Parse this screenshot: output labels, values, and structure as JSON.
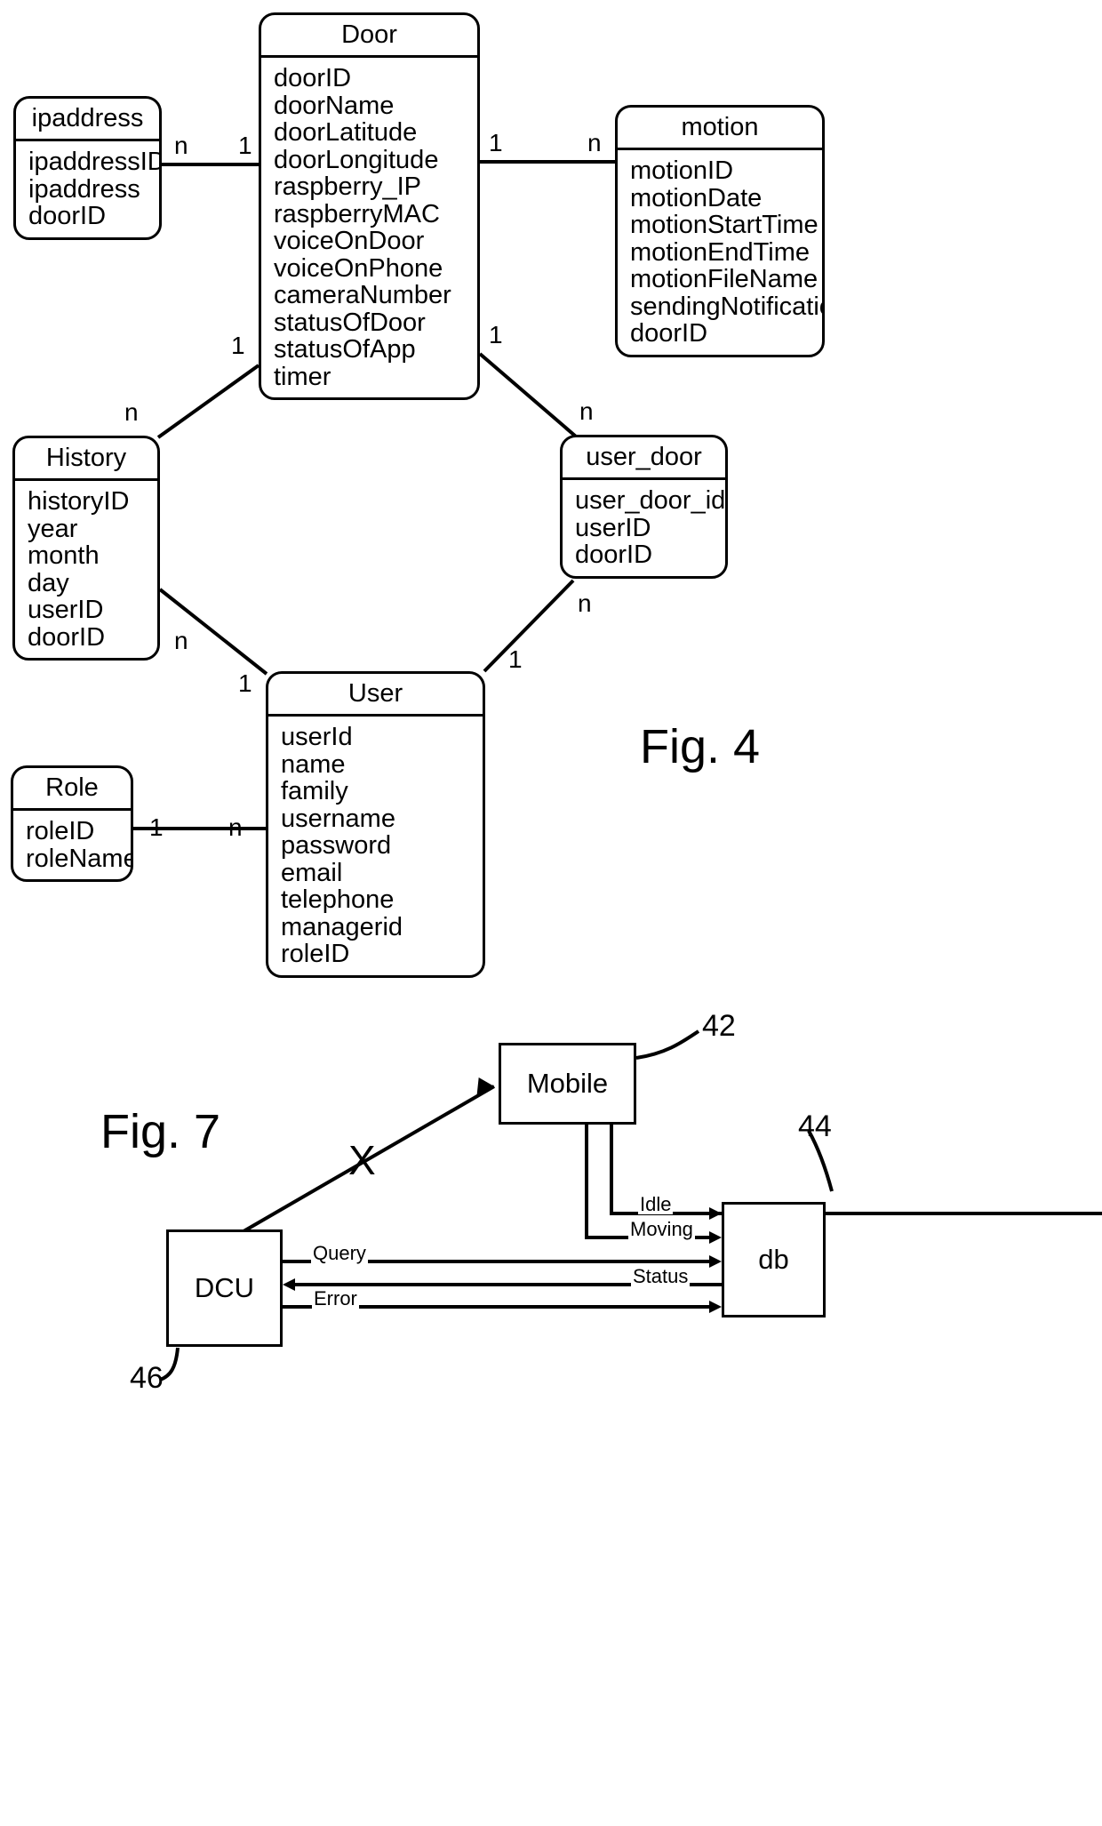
{
  "figures": [
    {
      "id": "fig4",
      "caption": "Fig. 4"
    },
    {
      "id": "fig7",
      "caption": "Fig. 7"
    }
  ],
  "fig4": {
    "caption": "Fig. 4",
    "entities": [
      {
        "name": "ipaddress",
        "attributes": [
          "ipaddressID",
          "ipaddress",
          "doorID"
        ]
      },
      {
        "name": "Door",
        "attributes": [
          "doorID",
          "doorName",
          "doorLatitude",
          "doorLongitude",
          "raspberry_IP",
          "raspberryMAC",
          "voiceOnDoor",
          "voiceOnPhone",
          "cameraNumber",
          "statusOfDoor",
          "statusOfApp",
          "timer"
        ]
      },
      {
        "name": "motion",
        "attributes": [
          "motionID",
          "motionDate",
          "motionStartTime",
          "motionEndTime",
          "motionFileName",
          "sendingNotification",
          "doorID"
        ]
      },
      {
        "name": "History",
        "attributes": [
          "historyID",
          "year",
          "month",
          "day",
          "userID",
          "doorID"
        ]
      },
      {
        "name": "user_door",
        "attributes": [
          "user_door_id",
          "userID",
          "doorID"
        ]
      },
      {
        "name": "User",
        "attributes": [
          "userId",
          "name",
          "family",
          "username",
          "password",
          "email",
          "telephone",
          "managerid",
          "roleID"
        ]
      },
      {
        "name": "Role",
        "attributes": [
          "roleID",
          "roleName"
        ]
      }
    ],
    "relationships": [
      {
        "from": "ipaddress",
        "to": "Door",
        "from_card": "n",
        "to_card": "1"
      },
      {
        "from": "Door",
        "to": "motion",
        "from_card": "1",
        "to_card": "n"
      },
      {
        "from": "Door",
        "to": "History",
        "from_card": "1",
        "to_card": "n"
      },
      {
        "from": "Door",
        "to": "user_door",
        "from_card": "1",
        "to_card": "n"
      },
      {
        "from": "History",
        "to": "User",
        "from_card": "n",
        "to_card": "1"
      },
      {
        "from": "user_door",
        "to": "User",
        "from_card": "n",
        "to_card": "1"
      },
      {
        "from": "Role",
        "to": "User",
        "from_card": "1",
        "to_card": "n"
      }
    ],
    "cardinality_labels": {
      "ipaddress_door_n": "n",
      "ipaddress_door_1": "1",
      "door_motion_1": "1",
      "door_motion_n": "n",
      "door_history_1": "1",
      "door_history_n": "n",
      "door_userdoor_1": "1",
      "door_userdoor_n": "n",
      "history_user_n": "n",
      "history_user_1": "1",
      "userdoor_user_n": "n",
      "userdoor_user_1": "1",
      "role_user_1": "1",
      "role_user_n": "n"
    }
  },
  "fig7": {
    "caption": "Fig. 7",
    "blocks": [
      {
        "id": "mobile",
        "label": "Mobile",
        "refnum": "42"
      },
      {
        "id": "db",
        "label": "db",
        "refnum": "44"
      },
      {
        "id": "dcu",
        "label": "DCU",
        "refnum": "46"
      }
    ],
    "signals": [
      {
        "label": "Idle",
        "from": "mobile",
        "to": "db"
      },
      {
        "label": "Moving",
        "from": "mobile",
        "to": "db"
      },
      {
        "label": "Query",
        "from": "dcu",
        "to": "db"
      },
      {
        "label": "Status",
        "from": "db",
        "to": "dcu"
      },
      {
        "label": "Error",
        "from": "dcu",
        "to": "db"
      }
    ],
    "broken_link_marker": "X",
    "refnums": {
      "mobile": "42",
      "db": "44",
      "dcu": "46"
    }
  }
}
